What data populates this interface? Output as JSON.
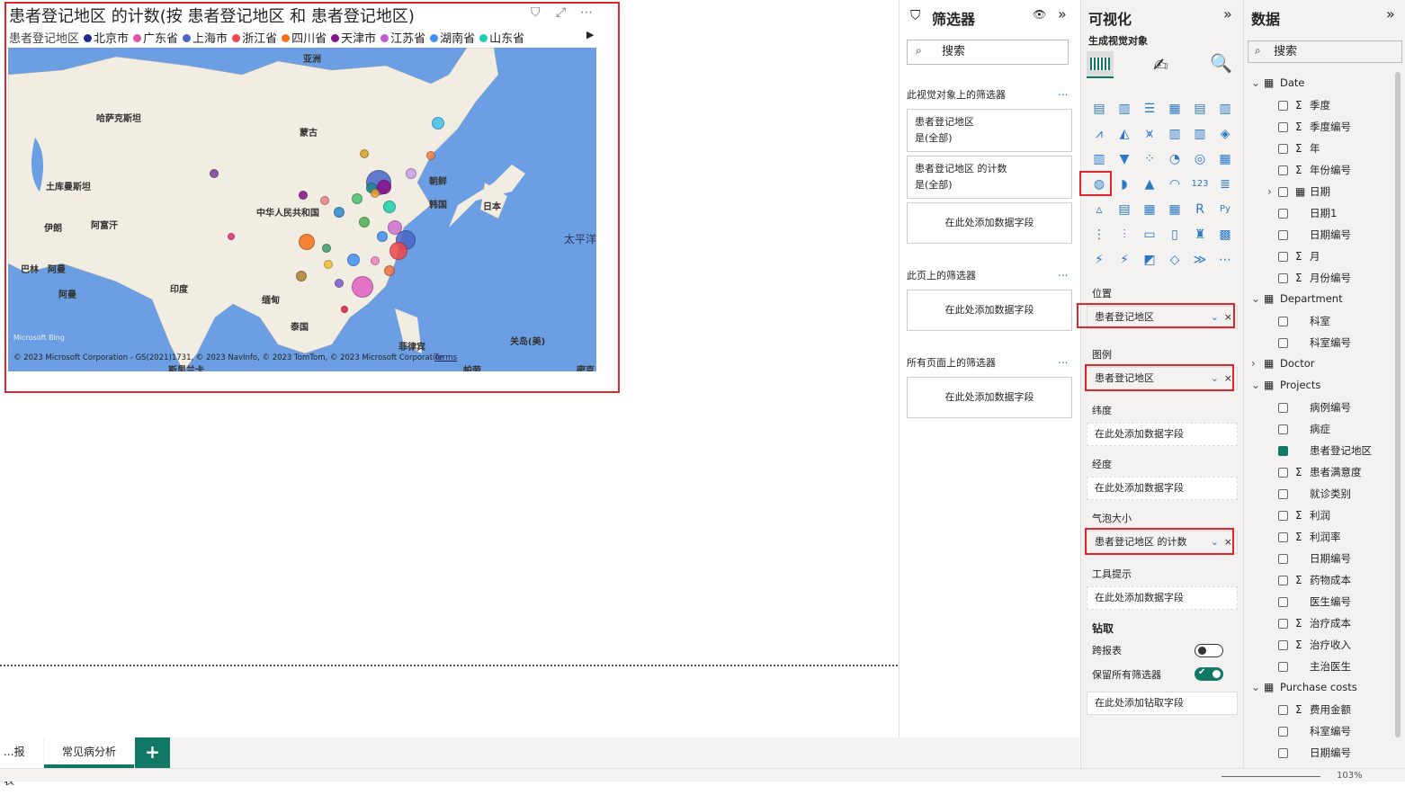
{
  "visual": {
    "title": "患者登记地区 的计数(按 患者登记地区 和 患者登记地区)",
    "legend_title": "患者登记地区",
    "legend": [
      {
        "label": "北京市",
        "color": "#1f2a8f"
      },
      {
        "label": "广东省",
        "color": "#e0569f"
      },
      {
        "label": "上海市",
        "color": "#4866c7"
      },
      {
        "label": "浙江省",
        "color": "#f2444a"
      },
      {
        "label": "四川省",
        "color": "#f57016"
      },
      {
        "label": "天津市",
        "color": "#8a0f8c"
      },
      {
        "label": "江苏省",
        "color": "#c05ad2"
      },
      {
        "label": "湖南省",
        "color": "#3f8ff5"
      },
      {
        "label": "山东省",
        "color": "#19d0b0"
      }
    ],
    "map_labels": [
      "亚洲",
      "哈萨克斯坦",
      "蒙古",
      "土库曼斯坦",
      "中华人民共和国",
      "朝鲜",
      "韩国",
      "日本",
      "太平洋",
      "伊朗",
      "阿富汗",
      "巴林",
      "阿曼",
      "阿曼",
      "印度",
      "缅甸",
      "泰国",
      "菲律宾",
      "关岛(美)",
      "斯里兰卡",
      "帕劳",
      "密克"
    ],
    "bing": "Microsoft Bing",
    "copyright": "© 2023 Microsoft Corporation - GS(2021)1731, © 2023 NavInfo, © 2023 TomTom, © 2023 Microsoft Corporation",
    "terms": "Terms"
  },
  "page_tabs": [
    {
      "label": "...报表"
    },
    {
      "label": "常见病分析",
      "active": true
    }
  ],
  "add_page": "+",
  "zoom": "103%",
  "filters": {
    "title": "筛选器",
    "search": "搜索",
    "visual_section": "此视觉对象上的筛选器",
    "cards": [
      {
        "name": "患者登记地区",
        "value": "是(全部)"
      },
      {
        "name": "患者登记地区 的计数",
        "value": "是(全部)"
      }
    ],
    "add": "在此处添加数据字段",
    "page_section": "此页上的筛选器",
    "all_section": "所有页面上的筛选器",
    "more": "..."
  },
  "viz": {
    "title": "可视化",
    "build": "生成视觉对象",
    "wells": [
      {
        "label": "位置",
        "value": "患者登记地区"
      },
      {
        "label": "图例",
        "value": "患者登记地区"
      },
      {
        "label": "纬度",
        "value": "在此处添加数据字段"
      },
      {
        "label": "经度",
        "value": "在此处添加数据字段"
      },
      {
        "label": "气泡大小",
        "value": "患者登记地区 的计数"
      },
      {
        "label": "工具提示",
        "value": "在此处添加数据字段"
      }
    ],
    "drill": "钻取",
    "cross_report": "跨报表",
    "cross_report_on": false,
    "keep_filters": "保留所有筛选器",
    "keep_filters_on": true,
    "add_drill": "在此处添加钻取字段"
  },
  "data": {
    "title": "数据",
    "search": "搜索",
    "items": [
      {
        "t": "table",
        "label": "Date",
        "open": true
      },
      {
        "label": "季度",
        "sigma": true
      },
      {
        "label": "季度编号",
        "sigma": true
      },
      {
        "label": "年",
        "sigma": true
      },
      {
        "label": "年份编号",
        "sigma": true
      },
      {
        "label": "日期",
        "sub": true
      },
      {
        "label": "日期1"
      },
      {
        "label": "日期编号"
      },
      {
        "label": "月",
        "sigma": true
      },
      {
        "label": "月份编号",
        "sigma": true
      },
      {
        "t": "table",
        "label": "Department",
        "open": true
      },
      {
        "label": "科室"
      },
      {
        "label": "科室编号"
      },
      {
        "t": "table",
        "label": "Doctor",
        "open": false
      },
      {
        "t": "table",
        "label": "Projects",
        "open": true
      },
      {
        "label": "病例编号"
      },
      {
        "label": "病症"
      },
      {
        "label": "患者登记地区",
        "checked": true
      },
      {
        "label": "患者满意度",
        "sigma": true
      },
      {
        "label": "就诊类别"
      },
      {
        "label": "利润",
        "sigma": true
      },
      {
        "label": "利润率",
        "sigma": true
      },
      {
        "label": "日期编号"
      },
      {
        "label": "药物成本",
        "sigma": true
      },
      {
        "label": "医生编号"
      },
      {
        "label": "治疗成本",
        "sigma": true
      },
      {
        "label": "治疗收入",
        "sigma": true
      },
      {
        "label": "主治医生"
      },
      {
        "t": "table",
        "label": "Purchase costs",
        "open": true
      },
      {
        "label": "费用金额",
        "sigma": true
      },
      {
        "label": "科室编号"
      },
      {
        "label": "日期编号"
      }
    ]
  }
}
